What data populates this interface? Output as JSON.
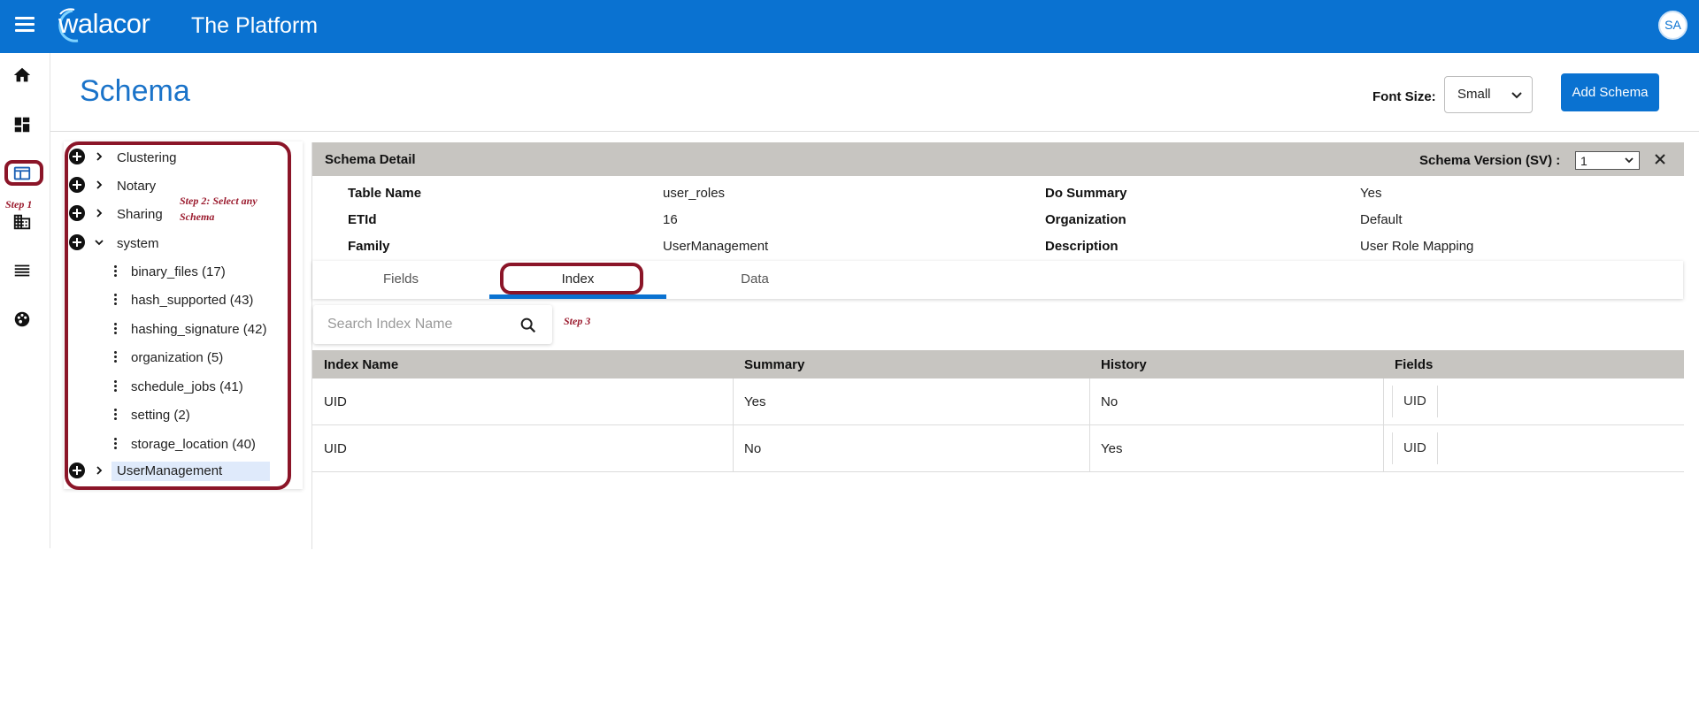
{
  "topbar": {
    "logo_text": "walacor",
    "app_title": "The Platform",
    "avatar_initials": "SA"
  },
  "rail": {
    "icons": [
      "home-icon",
      "dashboard-icon",
      "schema-icon",
      "organization-icon",
      "list-icon",
      "palette-icon"
    ],
    "step_label": "Step 1"
  },
  "header": {
    "page_title": "Schema",
    "font_size_label": "Font Size:",
    "font_size_value": "Small",
    "add_button_label": "Add Schema"
  },
  "tree": {
    "groups": [
      {
        "label": "Clustering",
        "expanded": false
      },
      {
        "label": "Notary",
        "expanded": false
      },
      {
        "label": "Sharing",
        "expanded": false
      },
      {
        "label": "system",
        "expanded": true
      }
    ],
    "system_children": [
      "binary_files (17)",
      "hash_supported (43)",
      "hashing_signature (42)",
      "organization (5)",
      "schedule_jobs (41)",
      "setting (2)",
      "storage_location (40)"
    ],
    "selected_group": "UserManagement",
    "step_label": "Step 2: Select any Schema"
  },
  "detail": {
    "title": "Schema Detail",
    "schema_version_label": "Schema Version (SV) :",
    "schema_version_value": "1",
    "meta": {
      "table_name_label": "Table Name",
      "table_name_value": "user_roles",
      "etid_label": "ETId",
      "etid_value": "16",
      "family_label": "Family",
      "family_value": "UserManagement",
      "do_summary_label": "Do Summary",
      "do_summary_value": "Yes",
      "organization_label": "Organization",
      "organization_value": "Default",
      "description_label": "Description",
      "description_value": "User Role Mapping"
    },
    "tabs": [
      "Fields",
      "Index",
      "Data"
    ],
    "active_tab": "Index",
    "search_placeholder": "Search Index Name",
    "step_label": "Step 3",
    "index_table": {
      "columns": [
        "Index Name",
        "Summary",
        "History",
        "Fields"
      ],
      "rows": [
        [
          "UID",
          "Yes",
          "No",
          "UID"
        ],
        [
          "UID",
          "No",
          "Yes",
          "UID"
        ]
      ]
    }
  },
  "colors": {
    "brand_blue": "#0a72d1",
    "header_gray": "#c7c5c1",
    "annotation_red": "#8b1528"
  }
}
